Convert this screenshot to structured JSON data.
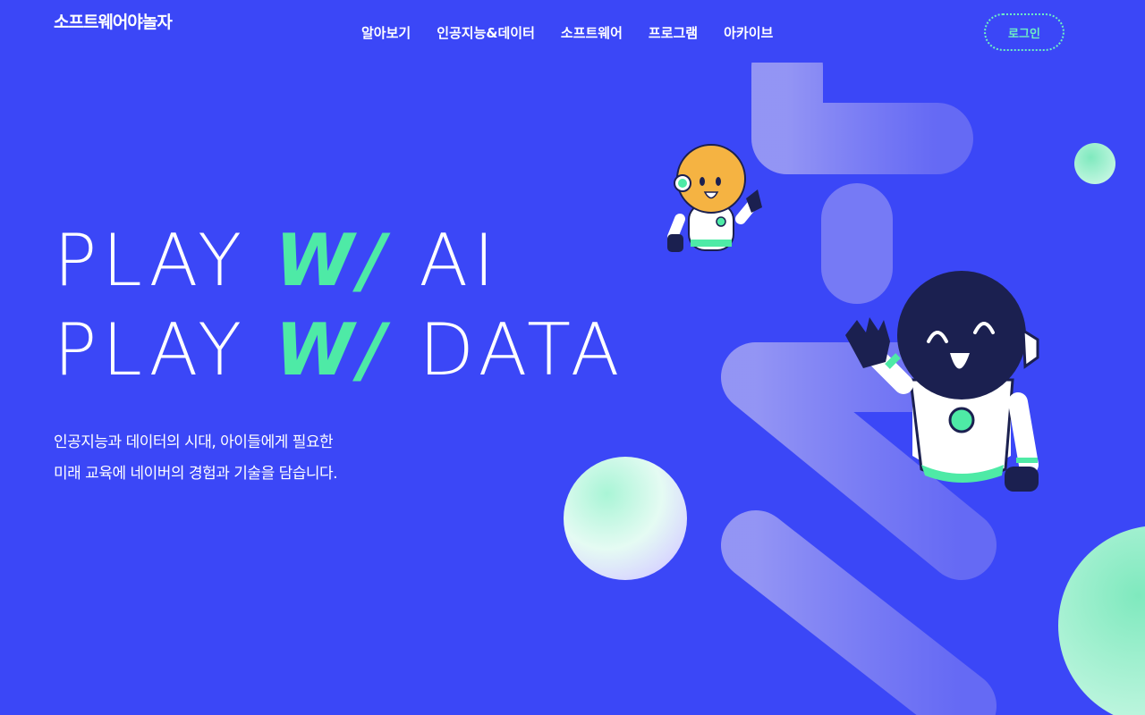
{
  "header": {
    "logo_text": "소프트웨어야놀자",
    "nav": [
      {
        "label": "알아보기"
      },
      {
        "label": "인공지능&데이터"
      },
      {
        "label": "소프트웨어"
      },
      {
        "label": "프로그램"
      },
      {
        "label": "아카이브"
      }
    ],
    "login_label": "로그인"
  },
  "hero": {
    "line1": {
      "play": "PLAY",
      "with": "W/",
      "subject": "AI"
    },
    "line2": {
      "play": "PLAY",
      "with": "W/",
      "subject": "DATA"
    },
    "description": [
      "인공지능과 데이터의 시대, 아이들에게 필요한",
      "미래 교육에 네이버의 경험과 기술을 담습니다."
    ]
  },
  "colors": {
    "background": "#3b47f7",
    "accent_green": "#4eeaa6",
    "login_border": "#6ef0c4",
    "robot_orange": "#f5b342",
    "robot_navy": "#1b2050"
  }
}
